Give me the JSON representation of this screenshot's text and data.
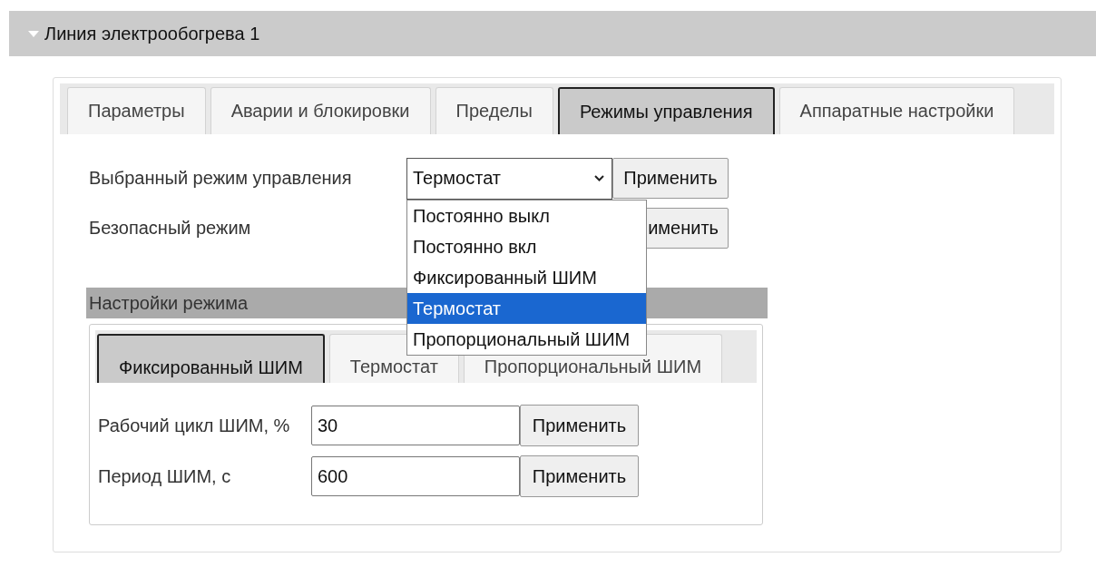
{
  "header": {
    "title": "Линия электрообогрева 1",
    "expanded": true
  },
  "tabs": [
    {
      "label": "Параметры",
      "selected": false
    },
    {
      "label": "Аварии и блокировки",
      "selected": false
    },
    {
      "label": "Пределы",
      "selected": false
    },
    {
      "label": "Режимы управления",
      "selected": true
    },
    {
      "label": "Аппаратные настройки",
      "selected": false
    }
  ],
  "control_rows": [
    {
      "label": "Выбранный режим управления",
      "kind": "select",
      "value": "Термостат",
      "button": "Применить"
    },
    {
      "label": "Безопасный режим",
      "kind": "covered",
      "button": "именить"
    }
  ],
  "dropdown": {
    "options": [
      {
        "label": "Постоянно выкл",
        "selected": false
      },
      {
        "label": "Постоянно вкл",
        "selected": false
      },
      {
        "label": "Фиксированный ШИМ",
        "selected": false
      },
      {
        "label": "Термостат",
        "selected": true
      },
      {
        "label": "Пропорциональный ШИМ",
        "selected": false
      }
    ]
  },
  "mode_settings": {
    "title": "Настройки режима",
    "tabs": [
      {
        "label": "Фиксированный ШИМ",
        "selected": true
      },
      {
        "label": "Термостат",
        "selected": false
      },
      {
        "label": "Пропорциональный ШИМ",
        "selected": false
      }
    ],
    "fields": [
      {
        "label": "Рабочий цикл ШИМ, %",
        "value": "30",
        "button": "Применить"
      },
      {
        "label": "Период ШИМ, с",
        "value": "600",
        "button": "Применить"
      }
    ]
  }
}
